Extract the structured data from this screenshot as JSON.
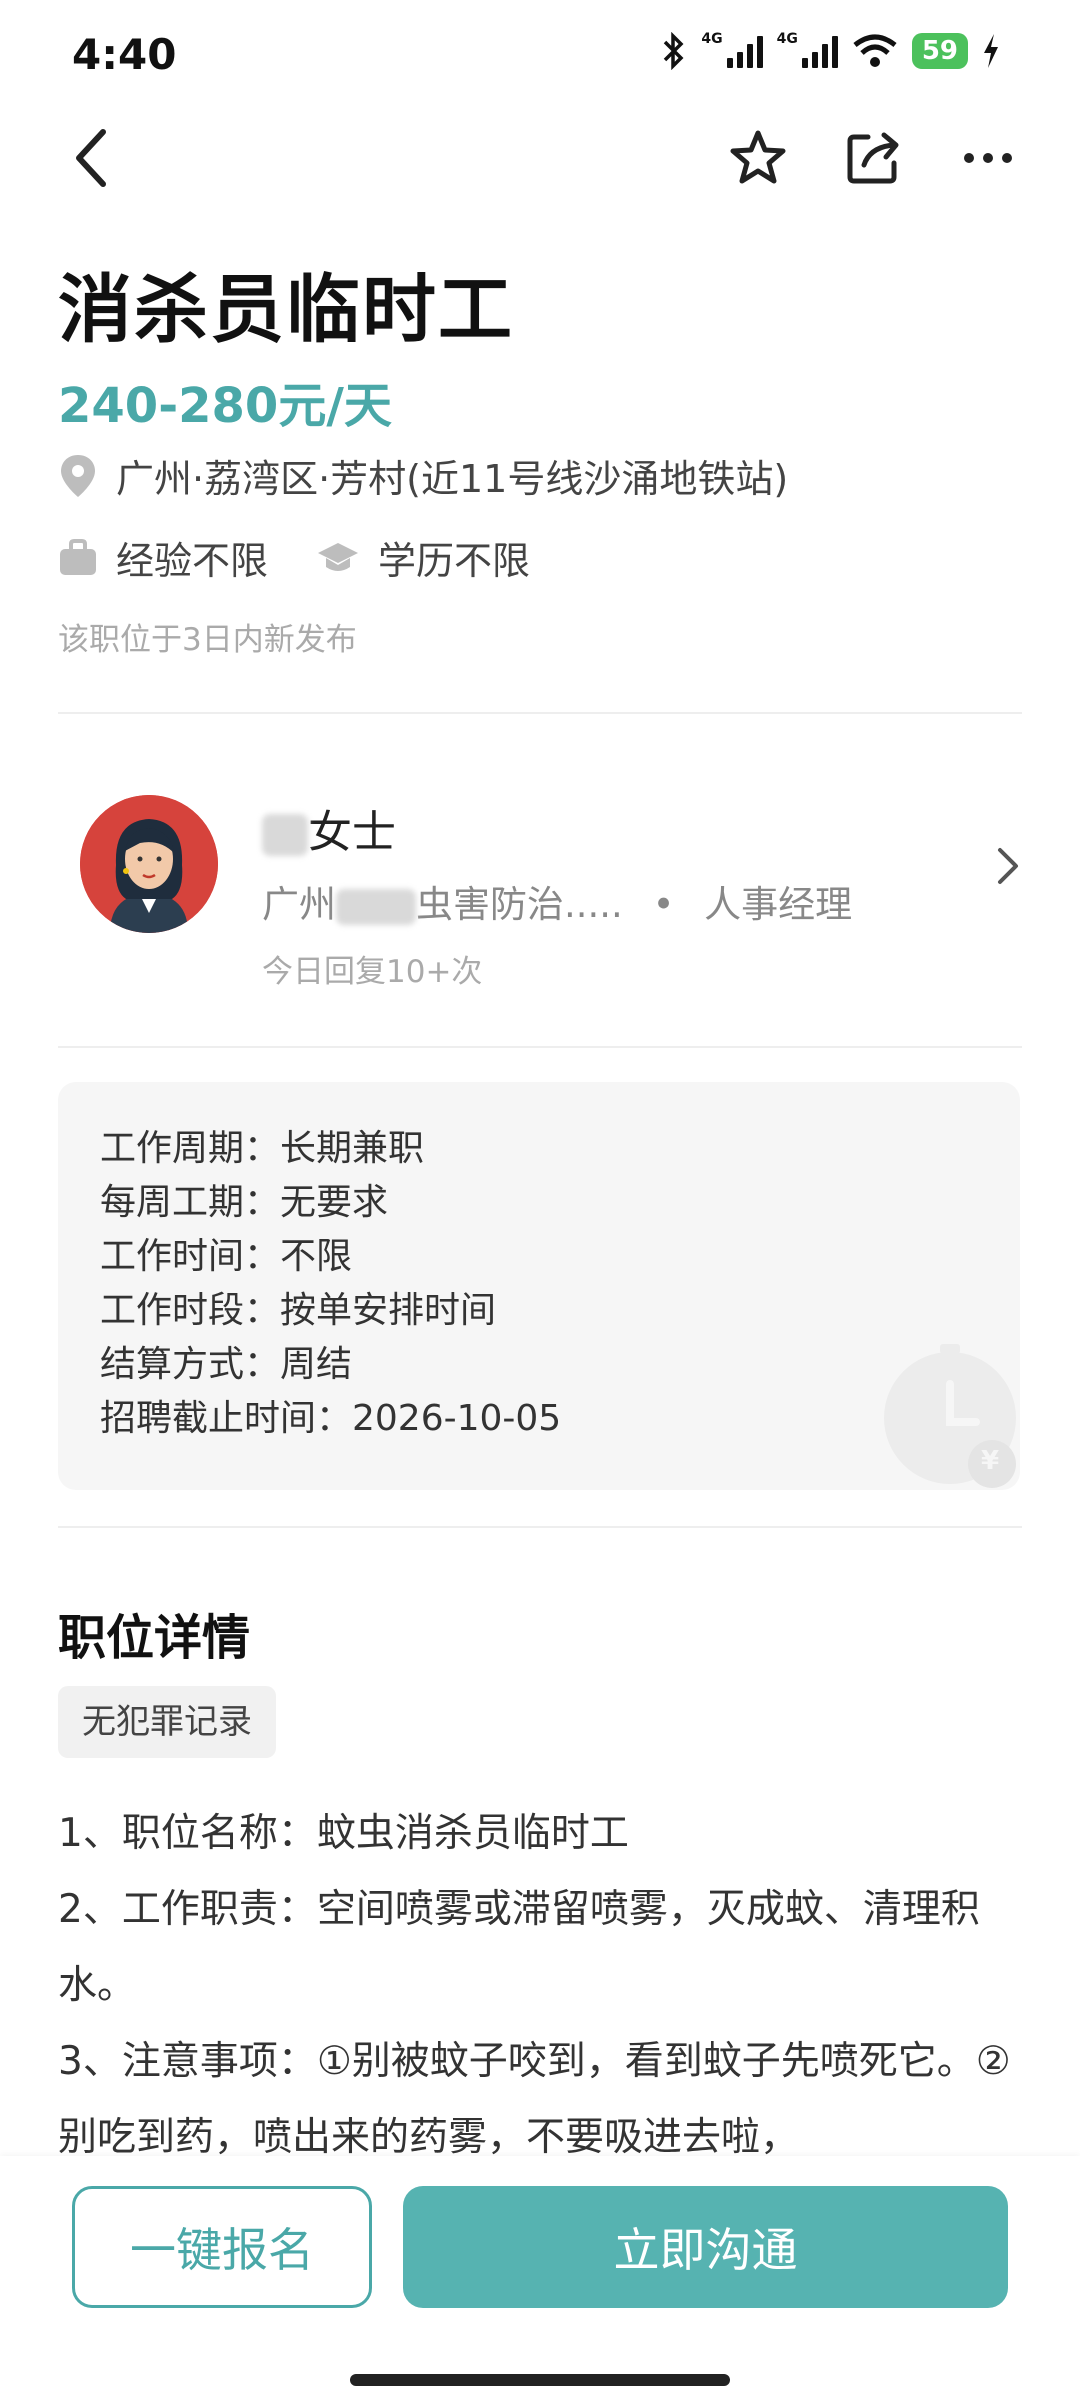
{
  "status_bar": {
    "time": "4:40",
    "network_1": "4G",
    "network_2": "4G",
    "battery": "59"
  },
  "job": {
    "title": "消杀员临时工",
    "salary": "240-280元/天",
    "location": "广州·荔湾区·芳村(近11号线沙涌地铁站)",
    "experience": "经验不限",
    "education": "学历不限",
    "posted": "该职位于3日内新发布"
  },
  "recruiter": {
    "name_suffix": "女士",
    "company_prefix": "广州",
    "company_suffix": "虫害防治.....",
    "separator": "•",
    "role": "人事经理",
    "reply": "今日回复10+次"
  },
  "info": {
    "lines": [
      "工作周期：长期兼职",
      "每周工期：无要求",
      "工作时间：不限",
      "工作时段：按单安排时间",
      "结算方式：周结",
      "招聘截止时间：2026-10-05"
    ],
    "watermark_symbol": "¥"
  },
  "details": {
    "section_title": "职位详情",
    "tag": "无犯罪记录",
    "paragraphs": [
      "1、职位名称：蚊虫消杀员临时工",
      "2、工作职责：空间喷雾或滞留喷雾，灭成蚊、清理积水。",
      "3、注意事项：①别被蚊子咬到，看到蚊子先喷死它。②别吃到药，喷出来的药雾，不要吸进去啦，"
    ]
  },
  "actions": {
    "apply_label": "一键报名",
    "chat_label": "立即沟通"
  },
  "colors": {
    "accent": "#4aa8a8",
    "button_fill": "#56b3b1",
    "battery": "#4cc15c"
  }
}
